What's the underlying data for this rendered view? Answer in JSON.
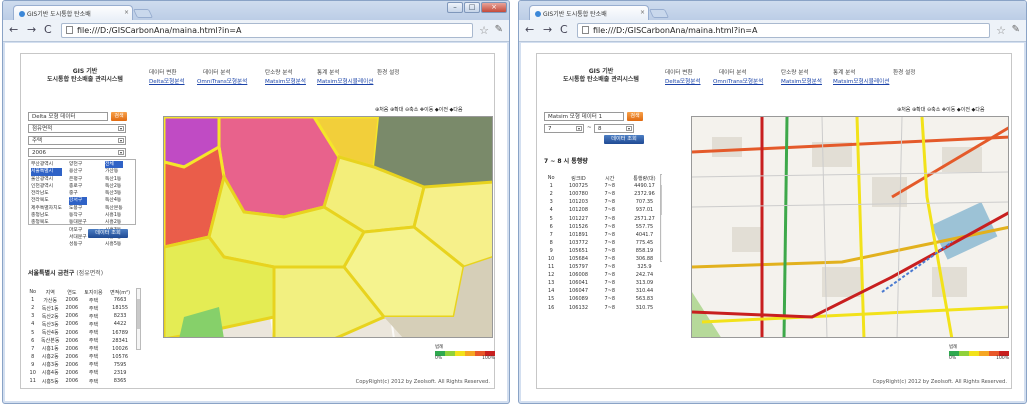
{
  "windows": [
    {
      "tab_title": "GIS기반 도시통합 탄소배",
      "url": "file:///D:/GISCarbonAna/maina.html?in=A",
      "logo": [
        "GIS 기반",
        "도시통합 탄소배출 관리시스템"
      ],
      "menu": [
        {
          "head": "데이터 변환",
          "sub": "Delta모형분석"
        },
        {
          "head": "데이터 분석",
          "sub": "OmniTrans모형분석"
        },
        {
          "head": "탄소량 분석",
          "sub": "Matsim모형분석"
        },
        {
          "head": "통계 분석",
          "sub": "Matsim모형시뮬레이션"
        },
        {
          "head": "환경 설정",
          "sub": ""
        }
      ],
      "left": {
        "data_select": "Delta 모형 데이터",
        "search_button": "검색",
        "select_area": "점유면적",
        "select_type": "주택",
        "select_year": "2006",
        "list_sido": [
          "부산광역시",
          "서울특별시",
          "울산광역시",
          "인천광역시",
          "전라남도",
          "전라북도",
          "제주특별자치도",
          "충청남도",
          "충청북도"
        ],
        "list_gu": [
          "양천구",
          "용산구",
          "은평구",
          "종로구",
          "중구",
          "강서구",
          "도봉구",
          "동작구",
          "동대문구",
          "마포구",
          "서대문구",
          "성동구"
        ],
        "list_dong": [
          "전체",
          "가산동",
          "독산1동",
          "독산2동",
          "독산3동",
          "독산4동",
          "독산본동",
          "시흥1동",
          "시흥2동",
          "시흥3동",
          "시흥4동",
          "시흥5동"
        ],
        "data_button": "데이터 조회",
        "result_title": "서울특별시 금천구",
        "result_unit": "(점유면적)",
        "table_headers": [
          "No",
          "지역",
          "연도",
          "토지이용",
          "면적(m²)"
        ],
        "rows": [
          [
            "1",
            "가산동",
            "2006",
            "주택",
            "7663"
          ],
          [
            "2",
            "독산1동",
            "2006",
            "주택",
            "18155"
          ],
          [
            "3",
            "독산2동",
            "2006",
            "주택",
            "8233"
          ],
          [
            "4",
            "독산3동",
            "2006",
            "주택",
            "4422"
          ],
          [
            "5",
            "독산4동",
            "2006",
            "주택",
            "16789"
          ],
          [
            "6",
            "독산본동",
            "2006",
            "주택",
            "28341"
          ],
          [
            "7",
            "시흥1동",
            "2006",
            "주택",
            "10026"
          ],
          [
            "8",
            "시흥2동",
            "2006",
            "주택",
            "10576"
          ],
          [
            "9",
            "시흥3동",
            "2006",
            "주택",
            "7595"
          ],
          [
            "10",
            "시흥4동",
            "2006",
            "주택",
            "2319"
          ],
          [
            "11",
            "시흥5동",
            "2006",
            "주택",
            "8365"
          ],
          [
            "12",
            "시흥본동",
            "2006",
            "주택",
            "17474"
          ]
        ]
      },
      "map_tools": "⊕처음 ⊕확대 ⊖축소 ✥이동 ◆이전 ◆다음",
      "legend_title": "범례",
      "legend_min": "0%",
      "legend_max": "100%",
      "copyright": "CopyRight(c) 2012 by Zeolsoft. All Rights Reserved."
    },
    {
      "tab_title": "GIS기반 도시통합 탄소배",
      "url": "file:///D:/GISCarbonAna/maina.html?in=A",
      "logo": [
        "GIS 기반",
        "도시통합 탄소배출 관리시스템"
      ],
      "menu": [
        {
          "head": "데이터 변환",
          "sub": "Delta모형분석"
        },
        {
          "head": "데이터 분석",
          "sub": "OmniTrans모형분석"
        },
        {
          "head": "탄소량 분석",
          "sub": "Matsim모형분석"
        },
        {
          "head": "통계 분석",
          "sub": "Matsim모형시뮬레이션"
        },
        {
          "head": "환경 설정",
          "sub": ""
        }
      ],
      "left": {
        "data_select": "Matsim 모형 데이터 1",
        "search_button": "검색",
        "time_from": "7",
        "time_sep": "~",
        "time_to": "8",
        "data_button": "데이터 조회",
        "section_title": "7 ~ 8 시 통행량",
        "table_headers": [
          "No",
          "링크ID",
          "시간",
          "통행량(대)"
        ],
        "rows": [
          [
            "1",
            "100725",
            "7~8",
            "4490.17"
          ],
          [
            "2",
            "100780",
            "7~8",
            "2372.96"
          ],
          [
            "3",
            "101203",
            "7~8",
            "707.35"
          ],
          [
            "4",
            "101208",
            "7~8",
            "937.01"
          ],
          [
            "5",
            "101227",
            "7~8",
            "2571.27"
          ],
          [
            "6",
            "101526",
            "7~8",
            "557.75"
          ],
          [
            "7",
            "101891",
            "7~8",
            "4041.7"
          ],
          [
            "8",
            "103772",
            "7~8",
            "775.45"
          ],
          [
            "9",
            "105651",
            "7~8",
            "858.19"
          ],
          [
            "10",
            "105684",
            "7~8",
            "306.88"
          ],
          [
            "11",
            "105797",
            "7~8",
            "325.9"
          ],
          [
            "12",
            "106008",
            "7~8",
            "242.74"
          ],
          [
            "13",
            "106041",
            "7~8",
            "313.09"
          ],
          [
            "14",
            "106047",
            "7~8",
            "310.44"
          ],
          [
            "15",
            "106089",
            "7~8",
            "563.83"
          ],
          [
            "16",
            "106132",
            "7~8",
            "310.75"
          ]
        ]
      },
      "map_tools": "⊕처음 ⊕확대 ⊖축소 ✥이동 ◆이전 ◆다음",
      "legend_title": "범례",
      "legend_min": "0%",
      "legend_max": "100%",
      "copyright": "CopyRight(c) 2012 by Zeolsoft. All Rights Reserved."
    }
  ],
  "colors": {
    "legend": [
      "#2fa84f",
      "#8fd13a",
      "#f2e21a",
      "#f5a623",
      "#e8582a",
      "#c81f1f"
    ],
    "accent_button": "#e87a1c",
    "link": "#1b43a8"
  }
}
